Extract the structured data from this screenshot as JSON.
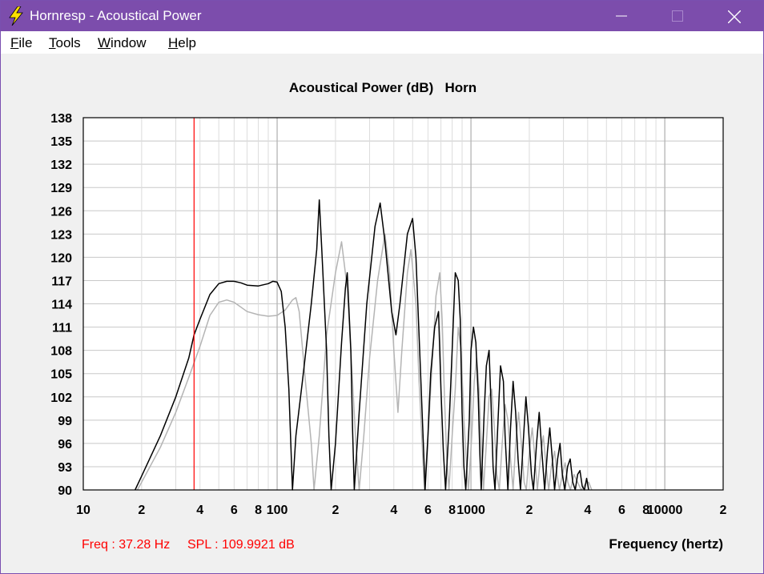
{
  "window": {
    "title": "Hornresp - Acoustical Power",
    "icon": "lightning-bolt-icon"
  },
  "menu": [
    {
      "label": "File",
      "mnemonic": "F",
      "rest": "ile"
    },
    {
      "label": "Tools",
      "mnemonic": "T",
      "rest": "ools"
    },
    {
      "label": "Window",
      "mnemonic": "W",
      "rest": "indow"
    },
    {
      "label": "Help",
      "mnemonic": "H",
      "rest": "elp"
    }
  ],
  "status": {
    "freq": "Freq : 37.28 Hz",
    "spl": "SPL : 109.9921 dB",
    "color": "#ff0000"
  },
  "chart_data": {
    "type": "line",
    "title": "Acoustical Power (dB)   Horn",
    "xlabel": "Frequency (hertz)",
    "x_scale": "log",
    "xlim": [
      10,
      20000
    ],
    "ylim": [
      90,
      138
    ],
    "y_ticks": [
      "138",
      "135",
      "132",
      "129",
      "126",
      "123",
      "120",
      "117",
      "114",
      "111",
      "108",
      "105",
      "102",
      "99",
      "96",
      "93",
      "90"
    ],
    "x_ticks": [
      {
        "value": 10,
        "label": "10"
      },
      {
        "value": 20,
        "label": "2"
      },
      {
        "value": 40,
        "label": "4"
      },
      {
        "value": 60,
        "label": "6"
      },
      {
        "value": 80,
        "label": "8"
      },
      {
        "value": 100,
        "label": "100"
      },
      {
        "value": 200,
        "label": "2"
      },
      {
        "value": 400,
        "label": "4"
      },
      {
        "value": 600,
        "label": "6"
      },
      {
        "value": 800,
        "label": "8"
      },
      {
        "value": 1000,
        "label": "1000"
      },
      {
        "value": 2000,
        "label": "2"
      },
      {
        "value": 4000,
        "label": "4"
      },
      {
        "value": 6000,
        "label": "6"
      },
      {
        "value": 8000,
        "label": "8"
      },
      {
        "value": 10000,
        "label": "10000"
      },
      {
        "value": 20000,
        "label": "2"
      }
    ],
    "grid": true,
    "cursor": {
      "x": 37.28,
      "color": "#ff0000"
    },
    "series": [
      {
        "color": "#000000",
        "points": [
          [
            18.5,
            90
          ],
          [
            20,
            91.8
          ],
          [
            25,
            97
          ],
          [
            30,
            102
          ],
          [
            35,
            107
          ],
          [
            37.28,
            110
          ],
          [
            40,
            112
          ],
          [
            45,
            115.2
          ],
          [
            50,
            116.6
          ],
          [
            55,
            116.9
          ],
          [
            60,
            116.9
          ],
          [
            65,
            116.7
          ],
          [
            70,
            116.4
          ],
          [
            80,
            116.3
          ],
          [
            90,
            116.6
          ],
          [
            95,
            116.9
          ],
          [
            100,
            116.8
          ],
          [
            105,
            115.6
          ],
          [
            110,
            111
          ],
          [
            115,
            103
          ],
          [
            120,
            90
          ],
          [
            125,
            97
          ],
          [
            135,
            104
          ],
          [
            150,
            114
          ],
          [
            160,
            121
          ],
          [
            165,
            127.4
          ],
          [
            170,
            121
          ],
          [
            180,
            108
          ],
          [
            185,
            97
          ],
          [
            190,
            90
          ],
          [
            200,
            96
          ],
          [
            215,
            109
          ],
          [
            225,
            116
          ],
          [
            230,
            118
          ],
          [
            240,
            108
          ],
          [
            245,
            98
          ],
          [
            250,
            90
          ],
          [
            265,
            100
          ],
          [
            290,
            114
          ],
          [
            320,
            124
          ],
          [
            340,
            127
          ],
          [
            360,
            122
          ],
          [
            390,
            113
          ],
          [
            410,
            110
          ],
          [
            430,
            114
          ],
          [
            470,
            123
          ],
          [
            500,
            125
          ],
          [
            520,
            120
          ],
          [
            550,
            105
          ],
          [
            570,
            95
          ],
          [
            580,
            90
          ],
          [
            600,
            97
          ],
          [
            620,
            105
          ],
          [
            650,
            111
          ],
          [
            680,
            113
          ],
          [
            700,
            103
          ],
          [
            720,
            95
          ],
          [
            740,
            90
          ],
          [
            770,
            98
          ],
          [
            800,
            108
          ],
          [
            830,
            118
          ],
          [
            860,
            117
          ],
          [
            880,
            112
          ],
          [
            900,
            100
          ],
          [
            920,
            93
          ],
          [
            940,
            90
          ],
          [
            980,
            99
          ],
          [
            1000,
            108
          ],
          [
            1030,
            111
          ],
          [
            1060,
            109
          ],
          [
            1090,
            102
          ],
          [
            1110,
            95
          ],
          [
            1130,
            90
          ],
          [
            1170,
            100
          ],
          [
            1200,
            106
          ],
          [
            1240,
            108
          ],
          [
            1270,
            101
          ],
          [
            1300,
            93
          ],
          [
            1330,
            90
          ],
          [
            1380,
            99
          ],
          [
            1420,
            106
          ],
          [
            1470,
            104
          ],
          [
            1500,
            97
          ],
          [
            1550,
            90
          ],
          [
            1600,
            98
          ],
          [
            1650,
            104
          ],
          [
            1700,
            100
          ],
          [
            1750,
            94
          ],
          [
            1800,
            90
          ],
          [
            1860,
            96
          ],
          [
            1920,
            102
          ],
          [
            1980,
            98
          ],
          [
            2050,
            92
          ],
          [
            2100,
            90
          ],
          [
            2180,
            96
          ],
          [
            2250,
            100
          ],
          [
            2320,
            95
          ],
          [
            2400,
            90
          ],
          [
            2480,
            95
          ],
          [
            2550,
            98
          ],
          [
            2630,
            94
          ],
          [
            2700,
            90
          ],
          [
            2800,
            94
          ],
          [
            2880,
            96
          ],
          [
            2960,
            92
          ],
          [
            3050,
            90
          ],
          [
            3150,
            93
          ],
          [
            3250,
            94
          ],
          [
            3350,
            91
          ],
          [
            3450,
            90
          ],
          [
            3550,
            92
          ],
          [
            3650,
            92.5
          ],
          [
            3750,
            90.5
          ],
          [
            3850,
            90
          ],
          [
            3950,
            91.5
          ],
          [
            4050,
            90
          ]
        ]
      },
      {
        "color": "#b4b4b4",
        "points": [
          [
            19,
            90
          ],
          [
            20,
            91
          ],
          [
            25,
            95.5
          ],
          [
            30,
            100
          ],
          [
            35,
            104.5
          ],
          [
            40,
            108.5
          ],
          [
            45,
            112.5
          ],
          [
            50,
            114.2
          ],
          [
            55,
            114.5
          ],
          [
            60,
            114.2
          ],
          [
            70,
            113
          ],
          [
            80,
            112.6
          ],
          [
            90,
            112.4
          ],
          [
            100,
            112.5
          ],
          [
            110,
            113.2
          ],
          [
            120,
            114.5
          ],
          [
            125,
            114.8
          ],
          [
            130,
            113
          ],
          [
            140,
            104
          ],
          [
            150,
            96
          ],
          [
            155,
            90
          ],
          [
            165,
            97
          ],
          [
            180,
            110
          ],
          [
            200,
            118
          ],
          [
            215,
            122
          ],
          [
            230,
            116
          ],
          [
            245,
            104
          ],
          [
            255,
            96
          ],
          [
            265,
            90
          ],
          [
            280,
            97
          ],
          [
            300,
            107
          ],
          [
            330,
            117
          ],
          [
            360,
            123
          ],
          [
            380,
            118
          ],
          [
            400,
            108
          ],
          [
            420,
            100
          ],
          [
            440,
            108
          ],
          [
            470,
            118
          ],
          [
            490,
            121
          ],
          [
            520,
            114
          ],
          [
            540,
            104
          ],
          [
            560,
            96
          ],
          [
            575,
            90
          ],
          [
            600,
            97
          ],
          [
            630,
            106
          ],
          [
            660,
            115
          ],
          [
            690,
            118
          ],
          [
            710,
            112
          ],
          [
            730,
            102
          ],
          [
            750,
            94
          ],
          [
            770,
            90
          ],
          [
            800,
            97
          ],
          [
            830,
            103
          ],
          [
            860,
            111
          ],
          [
            890,
            108
          ],
          [
            920,
            99
          ],
          [
            950,
            93
          ],
          [
            970,
            90
          ],
          [
            1010,
            97
          ],
          [
            1040,
            104
          ],
          [
            1070,
            107
          ],
          [
            1100,
            103
          ],
          [
            1130,
            96
          ],
          [
            1160,
            90
          ],
          [
            1200,
            96
          ],
          [
            1240,
            102
          ],
          [
            1280,
            103
          ],
          [
            1320,
            98
          ],
          [
            1360,
            92
          ],
          [
            1400,
            90
          ],
          [
            1450,
            96
          ],
          [
            1500,
            101
          ],
          [
            1550,
            99
          ],
          [
            1600,
            94
          ],
          [
            1650,
            90
          ],
          [
            1700,
            96
          ],
          [
            1760,
            100
          ],
          [
            1820,
            96
          ],
          [
            1880,
            91
          ],
          [
            1930,
            90
          ],
          [
            2000,
            95
          ],
          [
            2070,
            98
          ],
          [
            2140,
            94
          ],
          [
            2200,
            90
          ],
          [
            2280,
            94
          ],
          [
            2360,
            97
          ],
          [
            2440,
            93
          ],
          [
            2520,
            90
          ],
          [
            2600,
            93
          ],
          [
            2700,
            95
          ],
          [
            2780,
            92
          ],
          [
            2860,
            90
          ],
          [
            2960,
            92
          ],
          [
            3060,
            93.5
          ],
          [
            3160,
            91
          ],
          [
            3260,
            90
          ],
          [
            3400,
            92
          ],
          [
            3550,
            91
          ],
          [
            3700,
            90
          ],
          [
            3900,
            90.8
          ],
          [
            4050,
            91
          ],
          [
            4200,
            90
          ]
        ]
      }
    ]
  }
}
